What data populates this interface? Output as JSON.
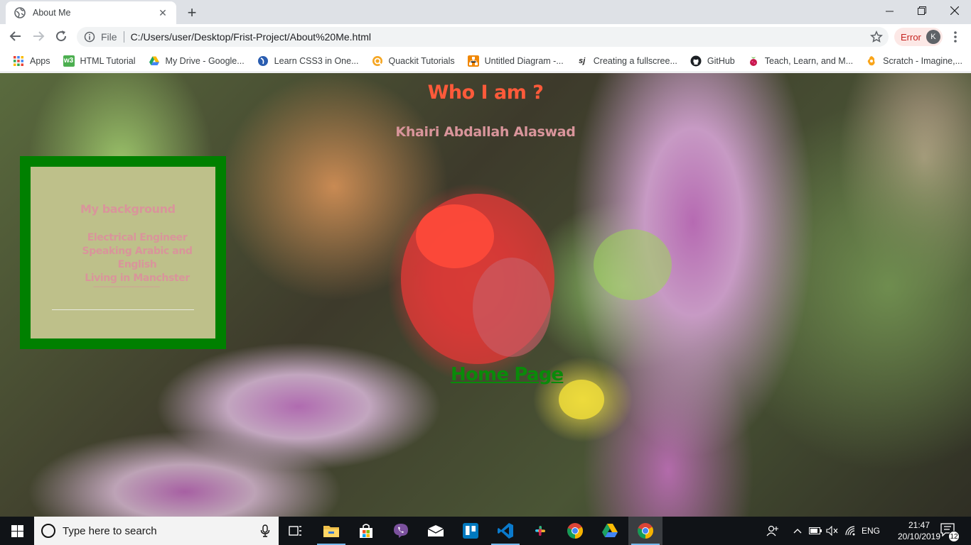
{
  "browser": {
    "tab": {
      "title": "About Me",
      "favicon": "globe-icon"
    },
    "new_tab_label": "+",
    "address": {
      "scheme": "File",
      "url": "C:/Users/user/Desktop/Frist-Project/About%20Me.html"
    },
    "profile": {
      "status": "Error",
      "initial": "K"
    },
    "bookmarks": [
      {
        "label": "Apps",
        "icon": "apps-grid-icon"
      },
      {
        "label": "HTML Tutorial",
        "icon": "w3schools-icon"
      },
      {
        "label": "My Drive - Google...",
        "icon": "google-drive-icon"
      },
      {
        "label": "Learn CSS3 in One...",
        "icon": "learn-css-icon"
      },
      {
        "label": "Quackit Tutorials",
        "icon": "quackit-icon"
      },
      {
        "label": "Untitled Diagram -...",
        "icon": "diagram-icon"
      },
      {
        "label": "Creating a fullscree...",
        "icon": "sj-icon"
      },
      {
        "label": "GitHub",
        "icon": "github-icon"
      },
      {
        "label": "Teach, Learn, and M...",
        "icon": "raspberry-pi-icon"
      },
      {
        "label": "Scratch - Imagine,...",
        "icon": "scratch-icon"
      }
    ]
  },
  "page": {
    "title": "Who I am ?",
    "subtitle": "Khairi Abdallah Alaswad",
    "background_box": {
      "heading": "My background",
      "lines": [
        "Electrical Engineer",
        "Speaking Arabic and English",
        "Living in Manchster"
      ],
      "dashes": "----------------------------------------"
    },
    "home_link": "Home Page"
  },
  "taskbar": {
    "search_placeholder": "Type here to search",
    "language": "ENG",
    "time": "21:47",
    "date": "20/10/2019",
    "notification_count": "12"
  },
  "colors": {
    "title": "#ff5a3a",
    "subtitle": "#d9959b",
    "box_border": "#008000",
    "box_fill": "#bec08a",
    "link": "#0a8a0a"
  }
}
